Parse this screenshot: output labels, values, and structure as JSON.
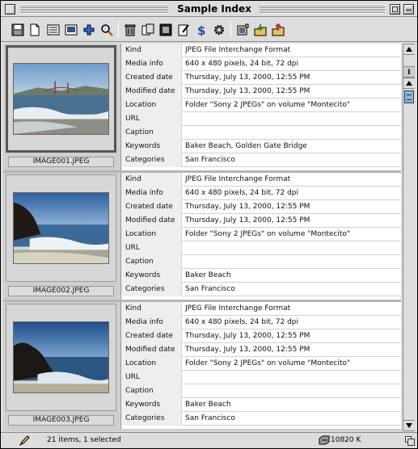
{
  "window": {
    "title": "Sample Index"
  },
  "toolbar": {
    "icons": [
      "save-icon",
      "new-document-icon",
      "list-view-icon",
      "thumbnail-view-icon",
      "add-icon",
      "find-icon",
      "trash-icon",
      "copy-icon",
      "slideshow-icon",
      "edit-icon",
      "dollar-icon",
      "gear-icon",
      "catalog-icon",
      "import-icon",
      "export-icon"
    ]
  },
  "field_labels": [
    "Kind",
    "Media info",
    "Created date",
    "Modified date",
    "Location",
    "URL",
    "Caption",
    "Keywords",
    "Categories"
  ],
  "records": [
    {
      "filename": "IMAGE001.JPEG",
      "selected": true,
      "fields": {
        "Kind": "JPEG File Interchange Format",
        "Media info": "640 x 480 pixels, 24 bit, 72 dpi",
        "Created date": "Thursday, July 13, 2000, 12:55 PM",
        "Modified date": "Thursday, July 13, 2000, 12:55 PM",
        "Location": "Folder \"Sony 2 JPEGs\" on volume \"Montecito\"",
        "URL": "",
        "Caption": "",
        "Keywords": "Baker Beach, Golden Gate Bridge",
        "Categories": "San Francisco"
      }
    },
    {
      "filename": "IMAGE002.JPEG",
      "selected": false,
      "fields": {
        "Kind": "JPEG File Interchange Format",
        "Media info": "640 x 480 pixels, 24 bit, 72 dpi",
        "Created date": "Thursday, July 13, 2000, 12:55 PM",
        "Modified date": "Thursday, July 13, 2000, 12:55 PM",
        "Location": "Folder \"Sony 2 JPEGs\" on volume \"Montecito\"",
        "URL": "",
        "Caption": "",
        "Keywords": "Baker Beach",
        "Categories": "San Francisco"
      }
    },
    {
      "filename": "IMAGE003.JPEG",
      "selected": false,
      "fields": {
        "Kind": "JPEG File Interchange Format",
        "Media info": "640 x 480 pixels, 24 bit, 72 dpi",
        "Created date": "Thursday, July 13, 2000, 12:55 PM",
        "Modified date": "Thursday, July 13, 2000, 12:55 PM",
        "Location": "Folder \"Sony 2 JPEGs\" on volume \"Montecito\"",
        "URL": "",
        "Caption": "",
        "Keywords": "Baker Beach",
        "Categories": "San Francisco"
      }
    }
  ],
  "scrollbar": {
    "info_label": "i"
  },
  "status": {
    "items_text": "21 items, 1 selected",
    "size_text": "10820 K"
  },
  "colors": {
    "window_bg": "#dddddd",
    "content_bg": "#cfcfcf",
    "scroll_thumb": "#8ab4d8"
  }
}
